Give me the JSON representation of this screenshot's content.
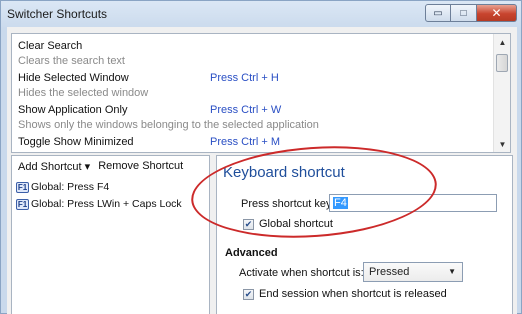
{
  "window": {
    "title": "Switcher Shortcuts",
    "min_glyph": "▭",
    "max_glyph": "□",
    "close_glyph": "✕"
  },
  "commands": [
    {
      "title": "Clear Search",
      "description": "Clears the search text",
      "key": ""
    },
    {
      "title": "Hide Selected Window",
      "description": "Hides the selected window",
      "key": "Press Ctrl + H"
    },
    {
      "title": "Show Application Only",
      "description": "Shows only the windows belonging to the selected application",
      "key": "Press Ctrl + W"
    },
    {
      "title": "Toggle Show Minimized",
      "description": "",
      "key": "Press Ctrl + M"
    }
  ],
  "scroll": {
    "up_glyph": "▲",
    "down_glyph": "▼"
  },
  "left": {
    "add_label": "Add Shortcut",
    "add_arrow": "▾",
    "remove_label": "Remove Shortcut",
    "key_badge": "F1",
    "items": [
      "Global: Press F4",
      "Global: Press LWin + Caps Lock"
    ]
  },
  "right": {
    "title": "Keyboard shortcut",
    "keys_label": "Press shortcut keys:",
    "keys_value": "F4",
    "global_label": "Global shortcut",
    "global_checked": true,
    "advanced_label": "Advanced",
    "activate_label": "Activate when shortcut is:",
    "activate_value": "Pressed",
    "select_arrow": "▼",
    "end_session_label": "End session when shortcut is released",
    "end_session_checked": true,
    "check_glyph": "✔"
  },
  "colors": {
    "accent": "#1f4e9b",
    "link_key": "#2a4fc4",
    "annotation": "#cc2a2a",
    "selection": "#3399ff"
  }
}
